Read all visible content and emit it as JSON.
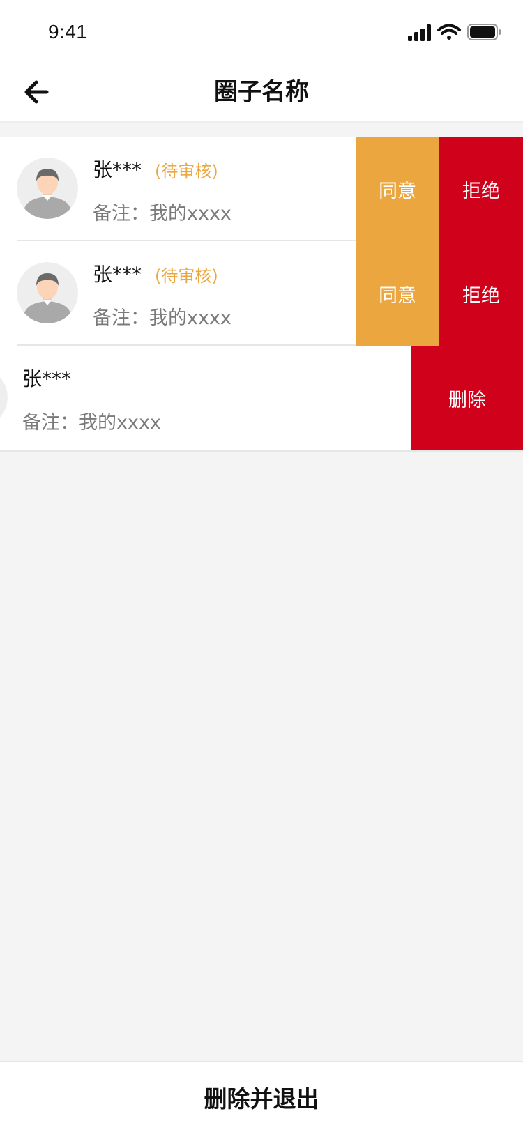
{
  "status_bar": {
    "time": "9:41",
    "icons": [
      "signal-icon",
      "wifi-icon",
      "battery-icon"
    ]
  },
  "nav": {
    "title": "圈子名称",
    "back_icon": "arrow-left-icon"
  },
  "members": [
    {
      "name": "张***",
      "status": "(待审核)",
      "remark": "备注：我的xxxx",
      "actions": [
        "同意",
        "拒绝"
      ]
    },
    {
      "name": "张***",
      "status": "(待审核)",
      "remark": "备注：我的xxxx",
      "actions": [
        "同意",
        "拒绝"
      ]
    },
    {
      "name": "张***",
      "status": "",
      "remark": "备注：我的xxxx",
      "actions": [
        "删除"
      ]
    }
  ],
  "bottom_button": "删除并退出",
  "colors": {
    "agree": "#eba63f",
    "reject": "#d0021b",
    "pending_status": "#eba63f",
    "background": "#f4f4f4"
  }
}
